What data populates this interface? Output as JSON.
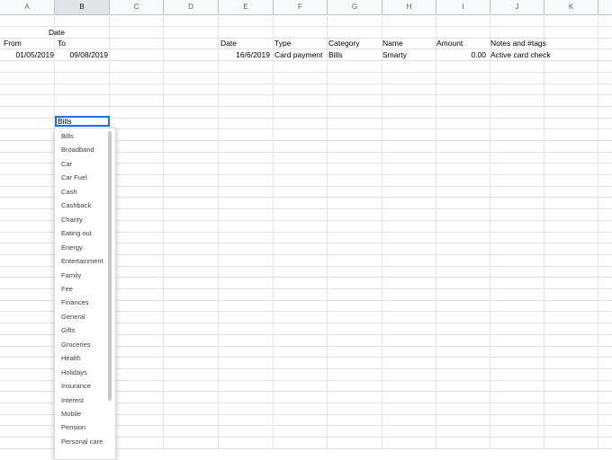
{
  "columns": [
    "A",
    "B",
    "C",
    "D",
    "E",
    "F",
    "G",
    "H",
    "I",
    "J",
    "K"
  ],
  "active_column": "B",
  "cells": {
    "b_date": "Date",
    "a_from": "From",
    "b_to": "To",
    "a_from_value": "01/05/2019",
    "b_to_value": "09/08/2019",
    "headers": [
      "Date",
      "Type",
      "Category",
      "Name",
      "Amount",
      "Notes and #tags"
    ],
    "row": [
      "16/6/2019",
      "Card payment",
      "Bills",
      "Smarty",
      "0.00",
      "Active card check"
    ]
  },
  "active_cell_value": "Bills",
  "dropdown_options": [
    "Bills",
    "Broadband",
    "Car",
    "Car Fuel",
    "Cash",
    "Cashback",
    "Charity",
    "Eating out",
    "Energy",
    "Entertainment",
    "Family",
    "Fee",
    "Finances",
    "General",
    "Gifts",
    "Groceries",
    "Health",
    "Holidays",
    "Insurance",
    "Interest",
    "Mobile",
    "Pension",
    "Personal care"
  ]
}
